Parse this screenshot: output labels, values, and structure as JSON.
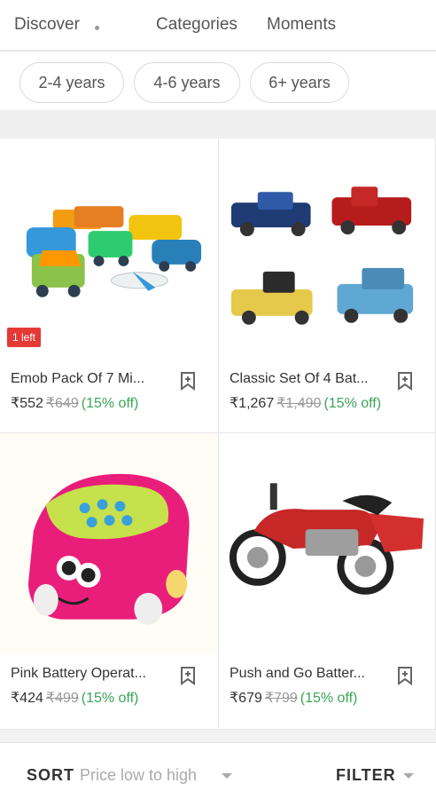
{
  "tabs": {
    "discover": "Discover",
    "categories": "Categories",
    "moments": "Moments"
  },
  "age_filters": [
    "2-4 years",
    "4-6 years",
    "6+ years"
  ],
  "products": [
    {
      "name": "Emob Pack Of 7 Mi...",
      "price": "₹552",
      "mrp": "₹649",
      "discount": "(15% off)",
      "badge": "1 left"
    },
    {
      "name": "Classic Set Of 4 Bat...",
      "price": "₹1,267",
      "mrp": "₹1,490",
      "discount": "(15% off)"
    },
    {
      "name": "Pink Battery Operat...",
      "price": "₹424",
      "mrp": "₹499",
      "discount": "(15% off)"
    },
    {
      "name": "Push and Go Batter...",
      "price": "₹679",
      "mrp": "₹799",
      "discount": "(15% off)"
    }
  ],
  "bottom_bar": {
    "sort_label": "SORT",
    "sort_value": "Price low to high",
    "filter_label": "FILTER"
  },
  "colors": {
    "discount_green": "#3aa45a",
    "badge_red": "#e53935"
  }
}
